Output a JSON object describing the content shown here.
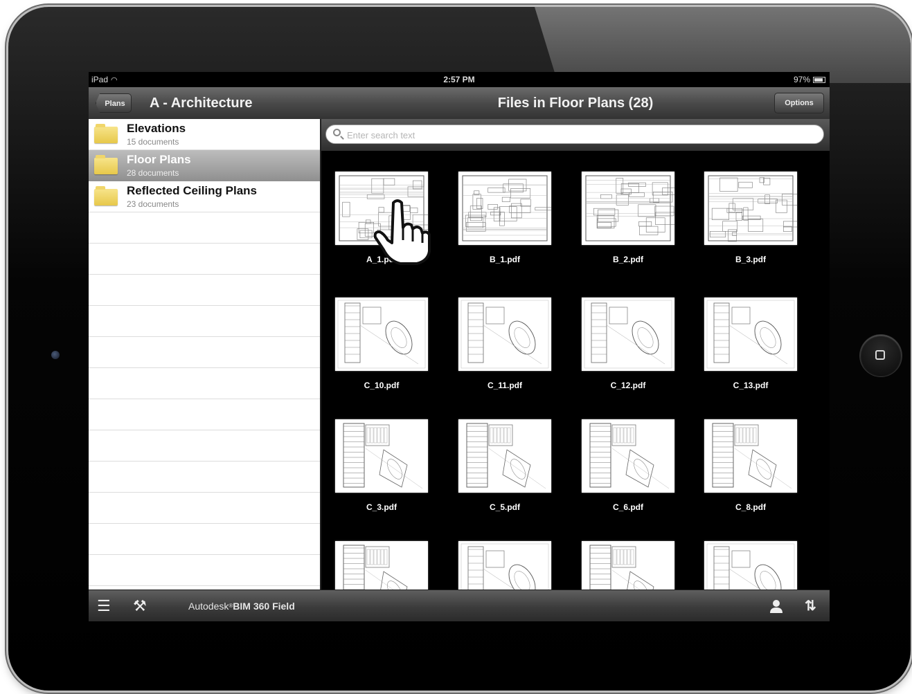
{
  "status_bar": {
    "carrier": "iPad",
    "time": "2:57 PM",
    "battery": "97%"
  },
  "nav": {
    "back_label": "Plans",
    "left_title": "A - Architecture",
    "center_title": "Files in Floor Plans (28)",
    "options_label": "Options"
  },
  "folders": [
    {
      "title": "Elevations",
      "subtitle": "15 documents",
      "selected": false
    },
    {
      "title": "Floor Plans",
      "subtitle": "28 documents",
      "selected": true
    },
    {
      "title": "Reflected Ceiling Plans",
      "subtitle": "23 documents",
      "selected": false
    }
  ],
  "search": {
    "placeholder": "Enter search text"
  },
  "files": [
    {
      "name": "A_1.pdf",
      "style": "plan"
    },
    {
      "name": "B_1.pdf",
      "style": "plan"
    },
    {
      "name": "B_2.pdf",
      "style": "plan"
    },
    {
      "name": "B_3.pdf",
      "style": "plan"
    },
    {
      "name": "C_10.pdf",
      "style": "site"
    },
    {
      "name": "C_11.pdf",
      "style": "site"
    },
    {
      "name": "C_12.pdf",
      "style": "site"
    },
    {
      "name": "C_13.pdf",
      "style": "site"
    },
    {
      "name": "C_3.pdf",
      "style": "tower"
    },
    {
      "name": "C_5.pdf",
      "style": "tower"
    },
    {
      "name": "C_6.pdf",
      "style": "tower"
    },
    {
      "name": "C_8.pdf",
      "style": "tower"
    },
    {
      "name": "",
      "style": "tower"
    },
    {
      "name": "",
      "style": "site"
    },
    {
      "name": "",
      "style": "tower"
    },
    {
      "name": "",
      "style": "site"
    }
  ],
  "toolbar": {
    "brand_prefix": "Autodesk",
    "brand_name": "BIM 360 Field",
    "icons": [
      "menu-icon",
      "tools-icon",
      "user-icon",
      "sort-icon"
    ]
  }
}
